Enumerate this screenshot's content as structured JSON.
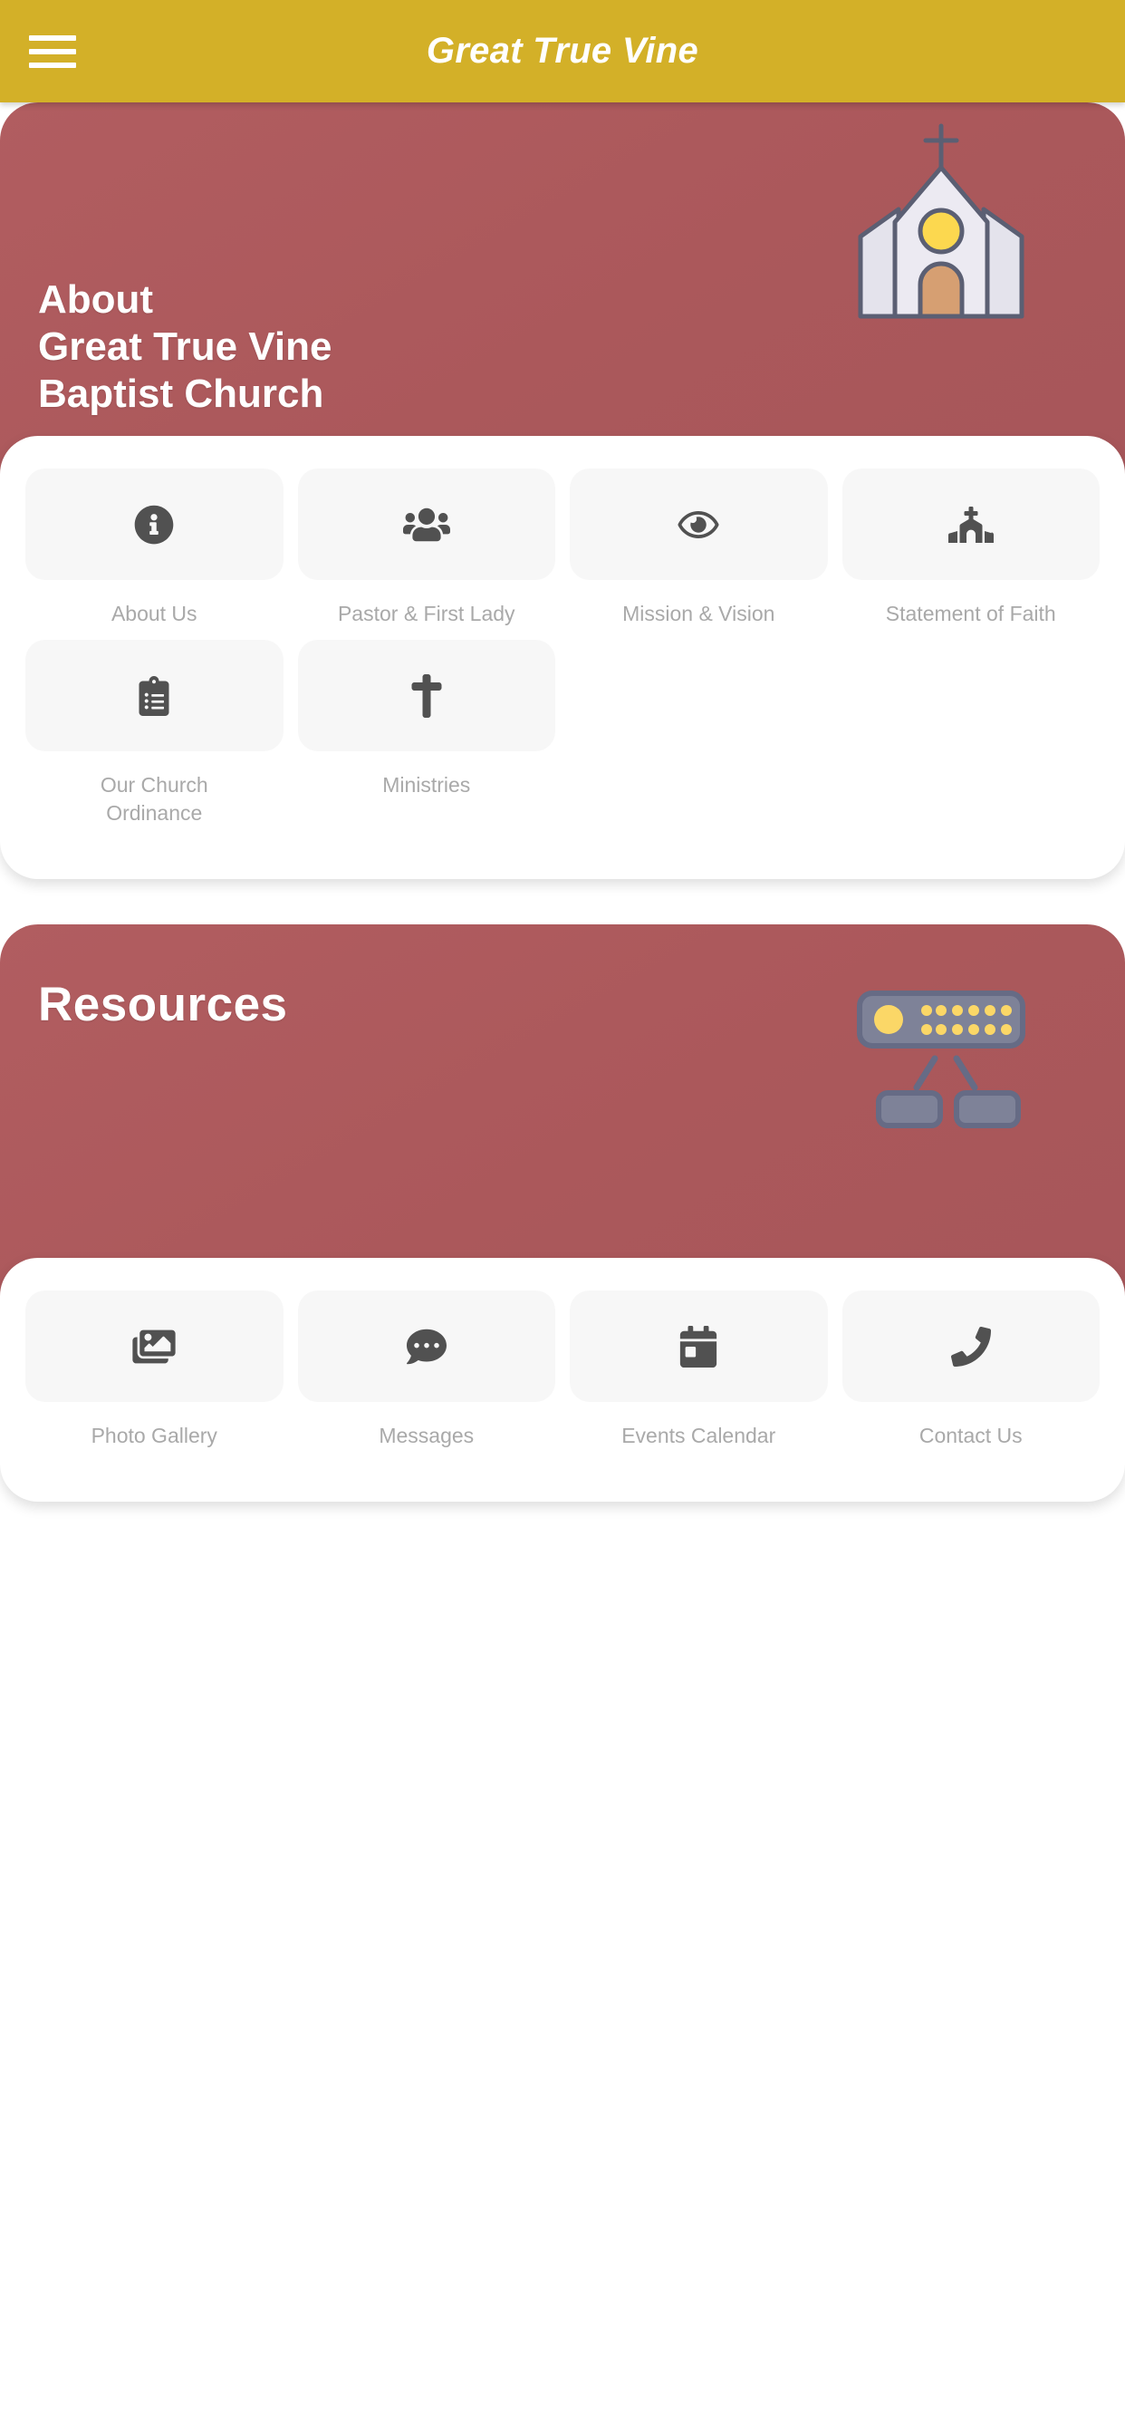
{
  "appbar": {
    "title": "Great True Vine",
    "menu_icon": "hamburger-menu-icon",
    "background": "#d3b028",
    "title_color": "#ffffff"
  },
  "theme": {
    "hero_red": "#ab585b",
    "gold": "#d3b028",
    "tile_bg": "#f7f7f7",
    "icon_color": "#515151",
    "label_color": "#a9a9a9",
    "page_bg": "#ffffff"
  },
  "sections": [
    {
      "id": "about",
      "hero_title": "About\nGreat True Vine\nBaptist Church",
      "hero_title_lines": [
        "About",
        "Great True Vine",
        "Baptist Church"
      ],
      "illustration": "church-building-illustration",
      "tiles": [
        {
          "label": "About Us",
          "icon": "info-circle-icon"
        },
        {
          "label": "Pastor & First Lady",
          "icon": "users-group-icon"
        },
        {
          "label": "Mission & Vision",
          "icon": "eye-icon"
        },
        {
          "label": "Statement of Faith",
          "icon": "church-icon"
        },
        {
          "label": "Our Church Ordinance",
          "icon": "clipboard-list-icon"
        },
        {
          "label": "Ministries",
          "icon": "cross-icon"
        }
      ]
    },
    {
      "id": "resources",
      "hero_title": "Resources",
      "hero_title_lines": [
        "Resources"
      ],
      "illustration": "network-router-illustration",
      "tiles": [
        {
          "label": "Photo Gallery",
          "icon": "images-icon"
        },
        {
          "label": "Messages",
          "icon": "comment-dots-icon"
        },
        {
          "label": "Events Calendar",
          "icon": "calendar-day-icon"
        },
        {
          "label": "Contact Us",
          "icon": "phone-icon"
        }
      ]
    }
  ]
}
